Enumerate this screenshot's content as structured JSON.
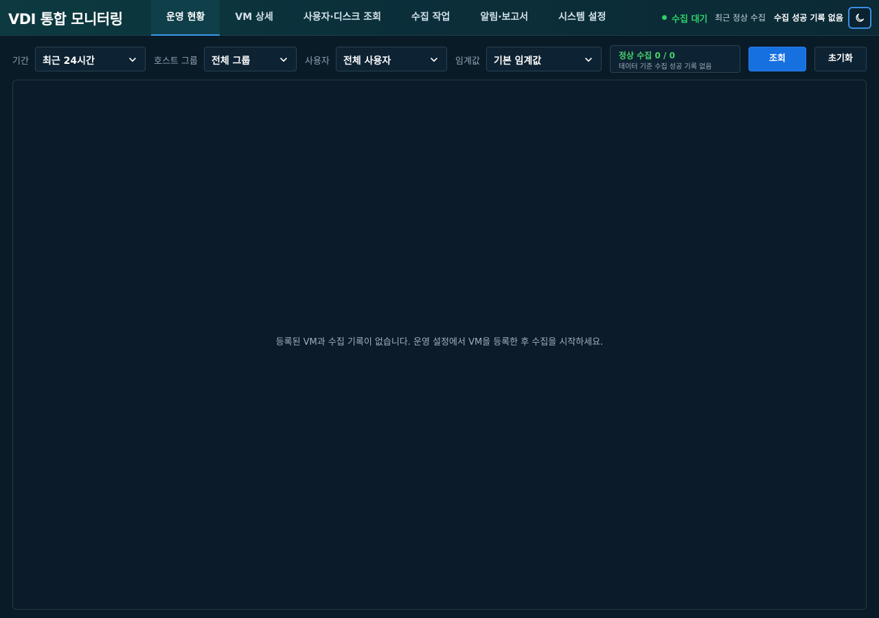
{
  "app": {
    "title": "VDI 통합 모니터링"
  },
  "nav": {
    "tabs": [
      {
        "label": "운영 현황",
        "active": true
      },
      {
        "label": "VM 상세",
        "active": false
      },
      {
        "label": "사용자·디스크 조회",
        "active": false
      },
      {
        "label": "수집 작업",
        "active": false
      },
      {
        "label": "알림·보고서",
        "active": false
      },
      {
        "label": "시스템 설정",
        "active": false
      }
    ]
  },
  "status": {
    "collect_state": "수집 대기",
    "last_label": "최근 정상 수집",
    "last_value": "수집 성공 기록 없음",
    "state_color": "#2ed06a"
  },
  "theme_toggle": {
    "icon": "moon-icon"
  },
  "filters": {
    "period": {
      "label": "기간",
      "value": "최근 24시간"
    },
    "host_group": {
      "label": "호스트 그룹",
      "value": "전체 그룹"
    },
    "user": {
      "label": "사용자",
      "value": "전체 사용자"
    },
    "threshold": {
      "label": "임계값",
      "value": "기본 임계값"
    }
  },
  "summary": {
    "title": "정상 수집 0 / 0",
    "subtitle": "데이터 기준 수집 성공 기록 없음"
  },
  "actions": {
    "query_label": "조회",
    "reset_label": "초기화"
  },
  "main": {
    "empty_message": "등록된 VM과 수집 기록이 없습니다. 운영 설정에서 VM을 등록한 후 수집을 시작하세요."
  },
  "colors": {
    "accent": "#1670e0",
    "success": "#2ed06a",
    "background": "#0a1b28"
  }
}
